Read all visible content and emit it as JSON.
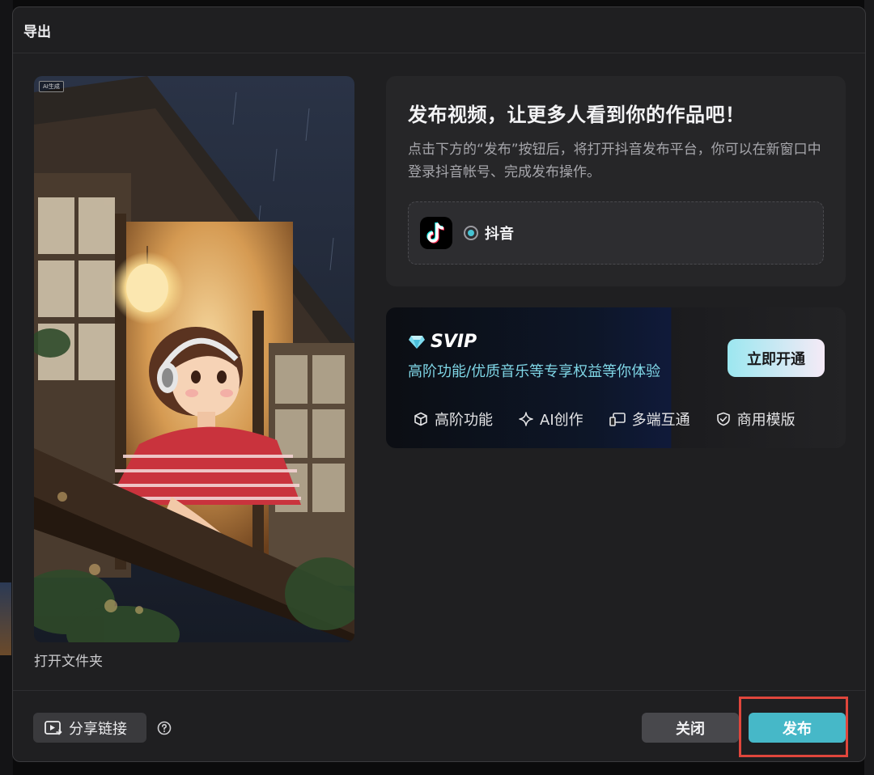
{
  "dialog": {
    "title": "导出"
  },
  "preview": {
    "badge": "AI生成",
    "open_folder": "打开文件夹"
  },
  "publish": {
    "title": "发布视频，让更多人看到你的作品吧！",
    "description": "点击下方的“发布”按钮后，将打开抖音发布平台，你可以在新窗口中登录抖音帐号、完成发布操作。",
    "platform": {
      "name": "抖音",
      "icon": "tiktok-logo-icon",
      "selected": true
    }
  },
  "svip": {
    "label": "SVIP",
    "icon": "diamond-icon",
    "description": "高阶功能/优质音乐等专享权益等你体验",
    "button": "立即开通",
    "features": [
      {
        "label": "高阶功能",
        "icon": "cube-icon"
      },
      {
        "label": "AI创作",
        "icon": "sparkle-icon"
      },
      {
        "label": "多端互通",
        "icon": "devices-icon"
      },
      {
        "label": "商用模版",
        "icon": "shield-check-icon"
      }
    ]
  },
  "footer": {
    "share_label": "分享链接",
    "close_label": "关闭",
    "publish_label": "发布"
  },
  "colors": {
    "accent": "#46b8c8",
    "radio": "#46c3d3",
    "svip_text": "#7fd6e6",
    "highlight": "#e0463c"
  }
}
